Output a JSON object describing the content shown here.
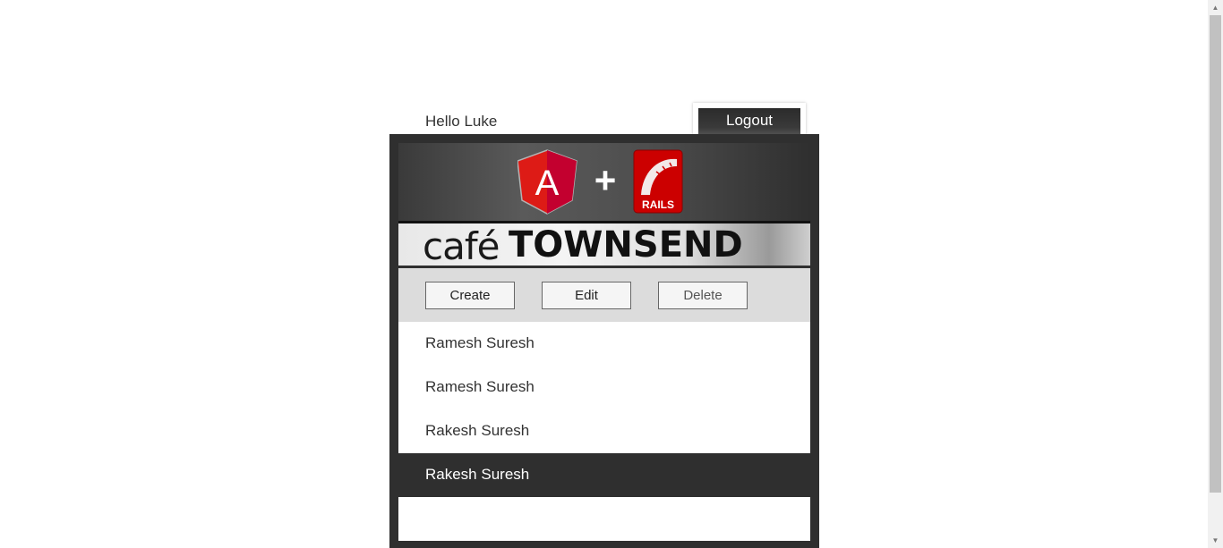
{
  "header": {
    "greeting": "Hello Luke",
    "logout_label": "Logout"
  },
  "banner": {
    "plus_sign": "+",
    "angular_logo_letter": "A",
    "rails_logo_text": "RAILS",
    "wordmark_cafe": "café",
    "wordmark_townsend": "TOWNSEND",
    "angular_color": "#dd1b16",
    "rails_color": "#cc0000"
  },
  "toolbar": {
    "create_label": "Create",
    "edit_label": "Edit",
    "delete_label": "Delete"
  },
  "employees": {
    "items": [
      {
        "name": "Ramesh Suresh",
        "selected": false
      },
      {
        "name": "Ramesh Suresh",
        "selected": false
      },
      {
        "name": "Rakesh Suresh",
        "selected": false
      },
      {
        "name": "Rakesh Suresh",
        "selected": true
      }
    ]
  },
  "scrollbar": {
    "up_icon": "▲",
    "down_icon": "▼"
  }
}
